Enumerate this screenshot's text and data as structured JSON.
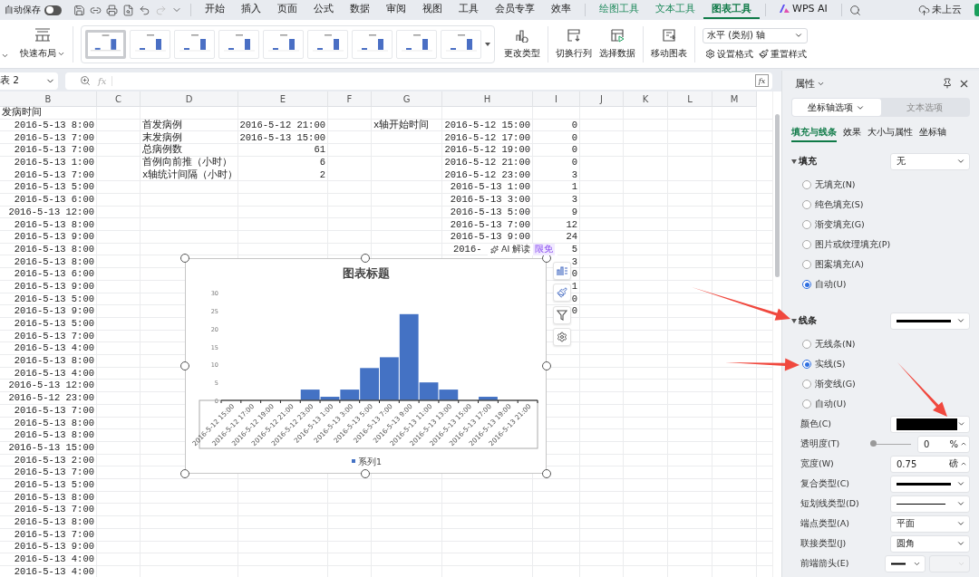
{
  "quick_access": {
    "autosave_label": "自动保存",
    "autosave_on": false
  },
  "menu_tabs": [
    {
      "label": "开始",
      "kind": "standard",
      "selected": false
    },
    {
      "label": "插入",
      "kind": "standard",
      "selected": false
    },
    {
      "label": "页面",
      "kind": "standard",
      "selected": false
    },
    {
      "label": "公式",
      "kind": "standard",
      "selected": false
    },
    {
      "label": "数据",
      "kind": "standard",
      "selected": false
    },
    {
      "label": "审阅",
      "kind": "standard",
      "selected": false
    },
    {
      "label": "视图",
      "kind": "standard",
      "selected": false
    },
    {
      "label": "工具",
      "kind": "standard",
      "selected": false
    },
    {
      "label": "会员专享",
      "kind": "standard",
      "selected": false
    },
    {
      "label": "效率",
      "kind": "standard",
      "selected": false
    },
    {
      "label": "绘图工具",
      "kind": "contextual",
      "selected": false
    },
    {
      "label": "文本工具",
      "kind": "contextual",
      "selected": false
    },
    {
      "label": "图表工具",
      "kind": "contextual",
      "selected": true
    },
    {
      "label": "WPS AI",
      "kind": "assistant",
      "selected": false
    }
  ],
  "cloud_status": "未上云",
  "ribbon": {
    "quick_layout": "快速布局",
    "styles": [
      {
        "selected": true
      },
      {
        "selected": false
      },
      {
        "selected": false
      },
      {
        "selected": false
      },
      {
        "selected": false
      },
      {
        "selected": false
      },
      {
        "selected": false
      },
      {
        "selected": false
      },
      {
        "selected": false
      }
    ],
    "change_type": "更改类型",
    "switch_row_col": "切换行列",
    "select_data": "选择数据",
    "move_chart": "移动图表",
    "element_select": "水平 (类别) 轴",
    "set_format": "设置格式",
    "reset_style": "重置样式"
  },
  "formula_bar": {
    "name_box": "表 2",
    "fx_label": "fx",
    "fx_button": "fx"
  },
  "sheet": {
    "columns": [
      "B",
      "C",
      "D",
      "E",
      "F",
      "G",
      "H",
      "I",
      "J",
      "K",
      "L",
      "M"
    ],
    "rows": [
      {
        "kind": "label",
        "b": "发病时间"
      },
      {
        "b": "2016-5-13 8:00",
        "d": "首发病例",
        "e": "2016-5-12 21:00",
        "g": "x轴开始时间",
        "h": "2016-5-12 15:00",
        "i": "0"
      },
      {
        "b": "2016-5-13 7:00",
        "d": "末发病例",
        "e": "2016-5-13 15:00",
        "h": "2016-5-12 17:00",
        "i": "0"
      },
      {
        "b": "2016-5-13 7:00",
        "d": "总病例数",
        "e": "61",
        "h": "2016-5-12 19:00",
        "i": "0"
      },
      {
        "b": "2016-5-13 1:00",
        "d": "首例向前推（小时）",
        "e": "6",
        "h": "2016-5-12 21:00",
        "i": "0"
      },
      {
        "b": "2016-5-13 7:00",
        "d": "x轴统计间隔（小时）",
        "e": "2",
        "h": "2016-5-12 23:00",
        "i": "3"
      },
      {
        "b": "2016-5-13 5:00",
        "h": "2016-5-13 1:00",
        "i": "1"
      },
      {
        "b": "2016-5-13 6:00",
        "h": "2016-5-13 3:00",
        "i": "3"
      },
      {
        "b": "2016-5-13 12:00",
        "h": "2016-5-13 5:00",
        "i": "9"
      },
      {
        "b": "2016-5-13 8:00",
        "h": "2016-5-13 7:00",
        "i": "12"
      },
      {
        "b": "2016-5-13 9:00",
        "h": "2016-5-13 9:00",
        "i": "24"
      },
      {
        "b": "2016-5-13 8:00",
        "h": "2016-",
        "covered": true,
        "i": "5"
      },
      {
        "b": "2016-5-13 8:00",
        "i": "3"
      },
      {
        "b": "2016-5-13 6:00",
        "i": "0"
      },
      {
        "b": "2016-5-13 9:00",
        "i": "1"
      },
      {
        "b": "2016-5-13 5:00",
        "i": "0"
      },
      {
        "b": "2016-5-13 9:00",
        "i": "0"
      },
      {
        "b": "2016-5-13 5:00"
      },
      {
        "b": "2016-5-13 7:00"
      },
      {
        "b": "2016-5-13 4:00"
      },
      {
        "b": "2016-5-13 8:00"
      },
      {
        "b": "2016-5-13 4:00"
      },
      {
        "b": "2016-5-13 12:00"
      },
      {
        "b": "2016-5-12 23:00"
      },
      {
        "b": "2016-5-13 7:00"
      },
      {
        "b": "2016-5-13 8:00"
      },
      {
        "b": "2016-5-13 8:00"
      },
      {
        "b": "2016-5-13 15:00"
      },
      {
        "b": "2016-5-13 2:00"
      },
      {
        "b": "2016-5-13 7:00"
      },
      {
        "b": "2016-5-13 5:00"
      },
      {
        "b": "2016-5-13 8:00"
      },
      {
        "b": "2016-5-13 7:00"
      },
      {
        "b": "2016-5-13 8:00"
      },
      {
        "b": "2016-5-13 7:00"
      },
      {
        "b": "2016-5-13 9:00"
      },
      {
        "b": "2016-5-13 4:00"
      },
      {
        "b": "2016-5-13 4:00"
      }
    ]
  },
  "chart": {
    "ai_badge": {
      "label": "AI 解读",
      "tag": "限免"
    },
    "chart_data": {
      "type": "bar",
      "title": "图表标题",
      "categories": [
        "2016-5-12 15:00",
        "2016-5-12 17:00",
        "2016-5-12 19:00",
        "2016-5-12 21:00",
        "2016-5-12 23:00",
        "2016-5-13 1:00",
        "2016-5-13 3:00",
        "2016-5-13 5:00",
        "2016-5-13 7:00",
        "2016-5-13 9:00",
        "2016-5-13 11:00",
        "2016-5-13 13:00",
        "2016-5-13 15:00",
        "2016-5-13 17:00",
        "2016-5-13 19:00",
        "2016-5-13 21:00"
      ],
      "series": [
        {
          "name": "系列1",
          "color": "#4472c4",
          "values": [
            0,
            0,
            0,
            0,
            3,
            1,
            3,
            9,
            12,
            24,
            5,
            3,
            0,
            1,
            0,
            0
          ]
        }
      ],
      "ylim": [
        0,
        30
      ],
      "yticks": [
        0,
        5,
        10,
        15,
        20,
        25,
        30
      ]
    }
  },
  "panel": {
    "title": "属性",
    "tabs": [
      {
        "label": "坐标轴选项",
        "selected": true
      },
      {
        "label": "文本选项",
        "selected": false
      }
    ],
    "subtabs": [
      {
        "label": "填充与线条",
        "selected": true
      },
      {
        "label": "效果",
        "selected": false
      },
      {
        "label": "大小与属性",
        "selected": false
      },
      {
        "label": "坐标轴",
        "selected": false
      }
    ],
    "fill": {
      "title": "填充",
      "expanded": true,
      "dropdown": "无",
      "options": [
        {
          "label": "无填充(N)",
          "selected": false
        },
        {
          "label": "纯色填充(S)",
          "selected": false
        },
        {
          "label": "渐变填充(G)",
          "selected": false
        },
        {
          "label": "图片或纹理填充(P)",
          "selected": false
        },
        {
          "label": "图案填充(A)",
          "selected": false
        },
        {
          "label": "自动(U)",
          "selected": true
        }
      ]
    },
    "line": {
      "title": "线条",
      "expanded": true,
      "options": [
        {
          "label": "无线条(N)",
          "selected": false
        },
        {
          "label": "实线(S)",
          "selected": true
        },
        {
          "label": "渐变线(G)",
          "selected": false
        },
        {
          "label": "自动(U)",
          "selected": false
        }
      ]
    },
    "properties": [
      {
        "kind": "color",
        "label": "颜色(C)"
      },
      {
        "kind": "slider",
        "label": "透明度(T)",
        "level": 0,
        "value": "0",
        "unit": "%"
      },
      {
        "kind": "spin",
        "label": "宽度(W)",
        "value": "0.75",
        "unit": "磅"
      },
      {
        "kind": "compound",
        "label": "复合类型(C)"
      },
      {
        "kind": "dash",
        "label": "短划线类型(D)"
      },
      {
        "kind": "select",
        "label": "端点类型(A)",
        "value": "平面"
      },
      {
        "kind": "select",
        "label": "联接类型(J)",
        "value": "圆角"
      },
      {
        "kind": "arrow",
        "label": "前端箭头(E)"
      }
    ]
  }
}
